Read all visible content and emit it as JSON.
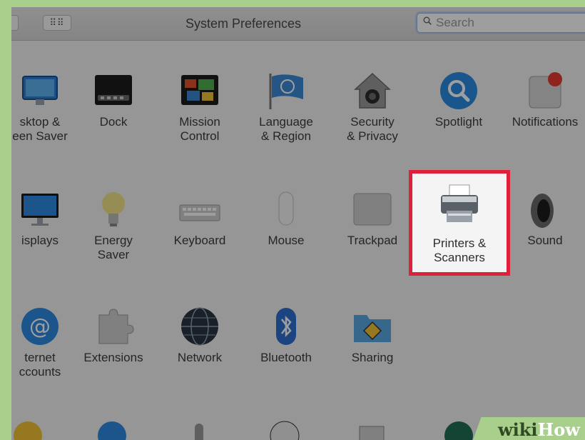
{
  "window": {
    "title": "System Preferences"
  },
  "toolbar": {
    "grid_glyph": "⠿⠿",
    "search_placeholder": "Search"
  },
  "rows": [
    [
      {
        "label": "sktop &\neen Saver",
        "icon": "desktop-icon"
      },
      {
        "label": "Dock",
        "icon": "dock-icon"
      },
      {
        "label": "Mission\nControl",
        "icon": "mission-control-icon"
      },
      {
        "label": "Language\n& Region",
        "icon": "language-flag-icon"
      },
      {
        "label": "Security\n& Privacy",
        "icon": "security-house-icon"
      },
      {
        "label": "Spotlight",
        "icon": "spotlight-magnifier-icon"
      },
      {
        "label": "Notifications",
        "icon": "notifications-icon"
      }
    ],
    [
      {
        "label": "isplays",
        "icon": "display-monitor-icon"
      },
      {
        "label": "Energy\nSaver",
        "icon": "lightbulb-icon"
      },
      {
        "label": "Keyboard",
        "icon": "keyboard-icon"
      },
      {
        "label": "Mouse",
        "icon": "mouse-icon"
      },
      {
        "label": "Trackpad",
        "icon": "trackpad-icon"
      },
      {
        "label": "Printers &\nScanners",
        "icon": "printer-icon"
      },
      {
        "label": "Sound",
        "icon": "speaker-icon"
      }
    ],
    [
      {
        "label": "ternet\nccounts",
        "icon": "at-sign-icon"
      },
      {
        "label": "Extensions",
        "icon": "puzzle-piece-icon"
      },
      {
        "label": "Network",
        "icon": "globe-network-icon"
      },
      {
        "label": "Bluetooth",
        "icon": "bluetooth-icon"
      },
      {
        "label": "Sharing",
        "icon": "sharing-folder-icon"
      }
    ]
  ],
  "highlight": {
    "label": "Printers &\nScanners",
    "color": "#e0203a"
  },
  "watermark": {
    "prefix": "wiki",
    "suffix": "How"
  }
}
